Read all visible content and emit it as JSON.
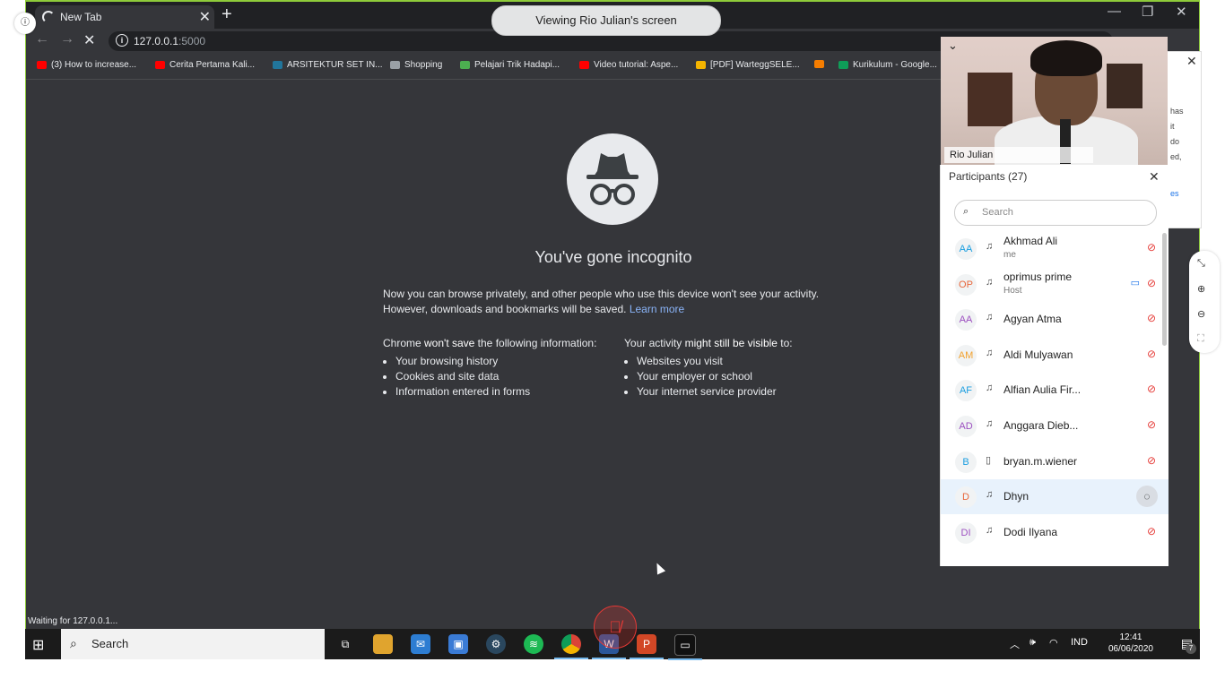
{
  "sharing_banner": "Viewing Rio Julian's screen",
  "left_indicator_icon": "info-icon",
  "browser": {
    "tab_title": "New Tab",
    "url_host": "127.0.0.1",
    "url_port": ":5000",
    "status_text": "Waiting for 127.0.0.1...",
    "bookmarks": [
      {
        "label": "(3) How to increase...",
        "icon_color": "#ff0000"
      },
      {
        "label": "Cerita Pertama Kali...",
        "icon_color": "#ff0000"
      },
      {
        "label": "ARSITEKTUR SET IN...",
        "icon_color": "#21759b"
      },
      {
        "label": "Shopping",
        "icon_color": "#9aa0a6"
      },
      {
        "label": "Pelajari Trik Hadapi...",
        "icon_color": "#4caf50"
      },
      {
        "label": "Video tutorial: Aspe...",
        "icon_color": "#ff0000"
      },
      {
        "label": "[PDF] WarteggSELE...",
        "icon_color": "#f4b400"
      },
      {
        "label": "",
        "icon_color": "#f57d00"
      },
      {
        "label": "Kurikulum - Google...",
        "icon_color": "#0f9d58"
      }
    ]
  },
  "incognito": {
    "title": "You've gone incognito",
    "intro_line1": "Now you can browse privately, and other people who use this device won't see your activity.",
    "intro_line2": "However, downloads and bookmarks will be saved.",
    "learn_more": "Learn more",
    "left_heading_pre": "Chrome ",
    "left_heading_bold": "won't save",
    "left_heading_post": " the following information:",
    "left_items": [
      "Your browsing history",
      "Cookies and site data",
      "Information entered in forms"
    ],
    "right_heading_pre": "Your activity ",
    "right_heading_bold": "might still be visible",
    "right_heading_post": " to:",
    "right_items": [
      "Websites you visit",
      "Your employer or school",
      "Your internet service provider"
    ]
  },
  "video": {
    "name": "Rio Julian"
  },
  "bg_card_lines": [
    "has",
    "it",
    "do",
    "ed,",
    "es"
  ],
  "participants": {
    "header": "Participants (27)",
    "search_placeholder": "Search",
    "list": [
      {
        "initials": "AA",
        "color": "#1a9ee0",
        "name": "Akhmad Ali",
        "sub": "me",
        "device": "headset",
        "mic": "muted",
        "cam": false
      },
      {
        "initials": "OP",
        "color": "#e8663a",
        "name": "oprimus prime",
        "sub": "Host",
        "device": "headset",
        "mic": "muted",
        "cam": true
      },
      {
        "initials": "AA",
        "color": "#9c4fc0",
        "name": "Agyan Atma",
        "sub": "",
        "device": "headset",
        "mic": "muted",
        "cam": false
      },
      {
        "initials": "AM",
        "color": "#f2a12d",
        "name": "Aldi Mulyawan",
        "sub": "",
        "device": "headset",
        "mic": "muted",
        "cam": false
      },
      {
        "initials": "AF",
        "color": "#1a9ee0",
        "name": "Alfian Aulia Fir...",
        "sub": "",
        "device": "headset",
        "mic": "muted",
        "cam": false
      },
      {
        "initials": "AD",
        "color": "#9c4fc0",
        "name": "Anggara Dieb...",
        "sub": "",
        "device": "headset",
        "mic": "muted",
        "cam": false
      },
      {
        "initials": "B",
        "color": "#1a9ee0",
        "name": "bryan.m.wiener",
        "sub": "",
        "device": "phone",
        "mic": "muted",
        "cam": false
      },
      {
        "initials": "D",
        "color": "#e8663a",
        "name": "Dhyn",
        "sub": "",
        "device": "headset",
        "mic": "chat",
        "cam": false
      },
      {
        "initials": "DI",
        "color": "#9c4fc0",
        "name": "Dodi Ilyana",
        "sub": "",
        "device": "headset",
        "mic": "muted",
        "cam": false
      }
    ]
  },
  "taskbar": {
    "search_placeholder": "Search",
    "apps": [
      "task-view",
      "file-explorer",
      "mail",
      "store",
      "steam",
      "spotify",
      "chrome",
      "word",
      "powerpoint",
      "terminal"
    ],
    "language": "IND",
    "time": "12:41",
    "date": "06/06/2020",
    "notification_count": "7"
  }
}
